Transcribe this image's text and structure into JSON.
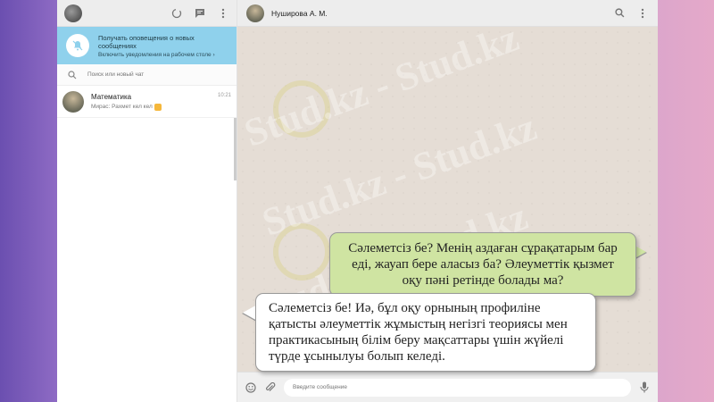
{
  "sidebar": {
    "notification": {
      "title": "Получать оповещения о новых сообщениях",
      "link": "Включить уведомления на рабочем столе ›"
    },
    "search": {
      "placeholder": "Поиск или новый чат"
    },
    "chats": [
      {
        "name": "Математика",
        "time": "10:21",
        "preview": "Мирас: Рахмет кел кел"
      }
    ]
  },
  "chat": {
    "title": "Нуширова А. М.",
    "footer": {
      "placeholder": "Введите сообщение"
    },
    "messages": [
      {
        "direction": "out",
        "text": "Сәлеметсіз бе? Менің аздаған сұрақатарым бар еді, жауап бере аласыз ба? Әлеуметтік қызмет оқу пәні ретінде болады ма?"
      },
      {
        "direction": "in",
        "text": "Сәлеметсіз бе! Иә, бұл оқу орнының профиліне қатысты әлеуметтік жұмыстың негізгі теориясы мен практикасының білім беру мақсаттары үшін жүйелі түрде ұсынылуы болып келеді."
      }
    ]
  },
  "watermark": {
    "text": "Stud.kz - Stud.kz"
  },
  "icons": {
    "status": "status-icon",
    "new_chat": "new-chat-icon",
    "menu": "menu-icon",
    "bell": "bell-off-icon",
    "search": "search-icon",
    "emoji": "emoji-icon",
    "attach": "attach-icon",
    "mic": "mic-icon"
  },
  "colors": {
    "header_bg": "#ededed",
    "notify_bg": "#8fd1ec",
    "chat_bg": "#e5ddd5",
    "bubble_out": "#cfe4a2",
    "bubble_in": "#ffffff"
  }
}
